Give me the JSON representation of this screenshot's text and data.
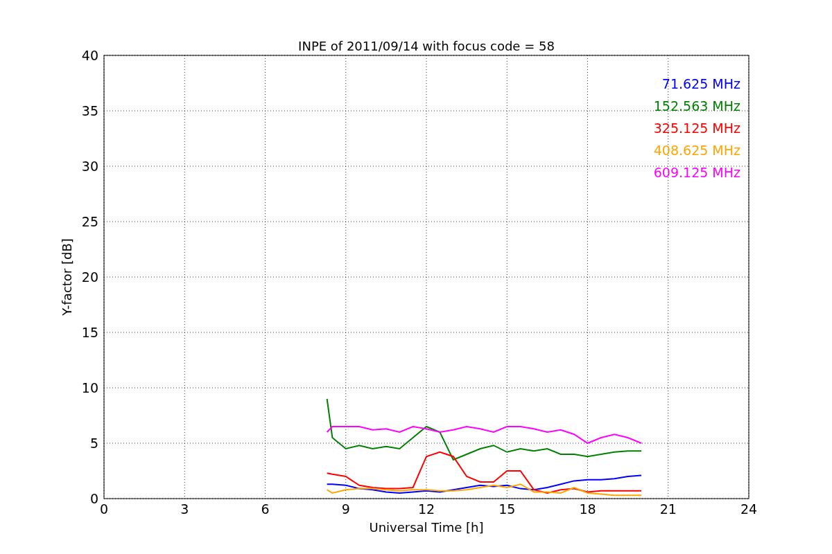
{
  "chart": {
    "chart_data": {
      "type": "line",
      "title": "INPE of 2011/09/14 with focus code = 58",
      "xlabel": "Universal Time [h]",
      "ylabel": "Y-factor [dB]",
      "x": [
        8.3,
        8.5,
        9,
        9.5,
        10,
        10.5,
        11,
        11.5,
        12,
        12.5,
        13,
        13.5,
        14,
        14.5,
        15,
        15.5,
        16,
        16.5,
        17,
        17.5,
        18,
        18.5,
        19,
        19.5,
        20
      ],
      "series": [
        {
          "name": "71.625 MHz",
          "color": "#0000ff",
          "values": [
            1.3,
            1.3,
            1.2,
            0.9,
            0.8,
            0.6,
            0.5,
            0.6,
            0.7,
            0.6,
            0.8,
            1.0,
            1.2,
            1.1,
            1.2,
            0.9,
            0.8,
            1.0,
            1.3,
            1.6,
            1.7,
            1.7,
            1.8,
            2.0,
            2.1
          ]
        },
        {
          "name": "152.563 MHz",
          "color": "#008000",
          "values": [
            9.0,
            5.5,
            4.5,
            4.8,
            4.5,
            4.7,
            4.5,
            5.5,
            6.5,
            6.0,
            3.5,
            4.0,
            4.5,
            4.8,
            4.2,
            4.5,
            4.3,
            4.5,
            4.0,
            4.0,
            3.8,
            4.0,
            4.2,
            4.3,
            4.3
          ]
        },
        {
          "name": "325.125 MHz",
          "color": "#ff0000",
          "values": [
            2.3,
            2.2,
            2.0,
            1.2,
            1.0,
            0.9,
            0.9,
            1.0,
            3.8,
            4.2,
            3.8,
            2.0,
            1.5,
            1.5,
            2.5,
            2.5,
            0.8,
            0.5,
            0.8,
            0.9,
            0.6,
            0.7,
            0.7,
            0.7,
            0.7
          ]
        },
        {
          "name": "408.625 MHz",
          "color": "#ffa500",
          "values": [
            0.8,
            0.5,
            0.8,
            0.9,
            0.9,
            0.8,
            0.7,
            0.8,
            0.8,
            0.7,
            0.7,
            0.8,
            1.0,
            1.2,
            1.0,
            1.3,
            0.6,
            0.6,
            0.5,
            1.0,
            0.5,
            0.4,
            0.3,
            0.3,
            0.3
          ]
        },
        {
          "name": "609.125 MHz",
          "color": "#ff00ff",
          "values": [
            6.0,
            6.5,
            6.5,
            6.5,
            6.2,
            6.3,
            6.0,
            6.5,
            6.3,
            6.0,
            6.2,
            6.5,
            6.3,
            6.0,
            6.5,
            6.5,
            6.3,
            6.0,
            6.2,
            5.8,
            5.0,
            5.5,
            5.8,
            5.5,
            5.0
          ]
        }
      ],
      "xlim": [
        0,
        24
      ],
      "ylim": [
        0,
        40
      ],
      "xticks": [
        0,
        3,
        6,
        9,
        12,
        15,
        18,
        21,
        24
      ],
      "yticks": [
        0,
        5,
        10,
        15,
        20,
        25,
        30,
        35,
        40
      ],
      "grid": true
    }
  }
}
